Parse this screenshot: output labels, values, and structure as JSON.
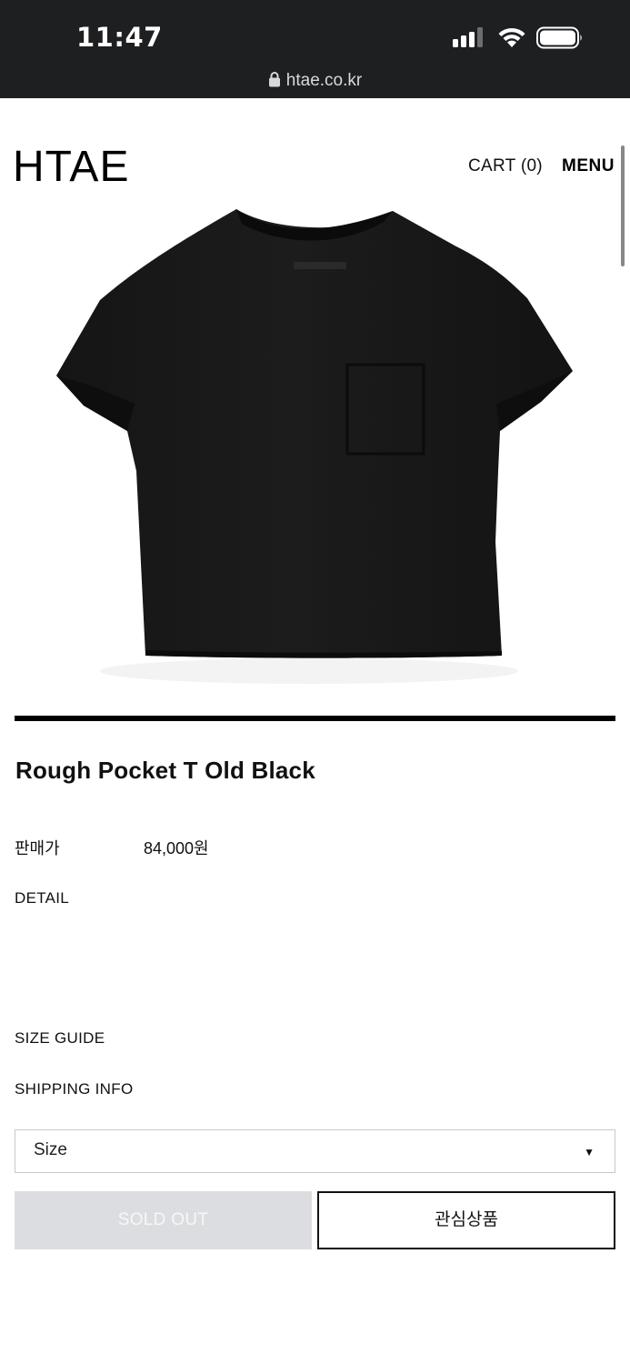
{
  "status_bar": {
    "time": "11:47",
    "url": "htae.co.kr"
  },
  "header": {
    "logo": "HTAE",
    "cart_label": "CART (0)",
    "menu_label": "MENU"
  },
  "product": {
    "title": "Rough Pocket T Old Black",
    "price_label": "판매가",
    "price_value": "84,000원",
    "detail_label": "DETAIL",
    "size_guide_label": "SIZE GUIDE",
    "shipping_info_label": "SHIPPING INFO",
    "size_select": {
      "selected": "Size"
    },
    "soldout_label": "SOLD OUT",
    "wishlist_label": "관심상품"
  },
  "colors": {
    "status_bg": "#1e1f21",
    "soldout_bg": "#dcdde0",
    "text": "#111111"
  }
}
